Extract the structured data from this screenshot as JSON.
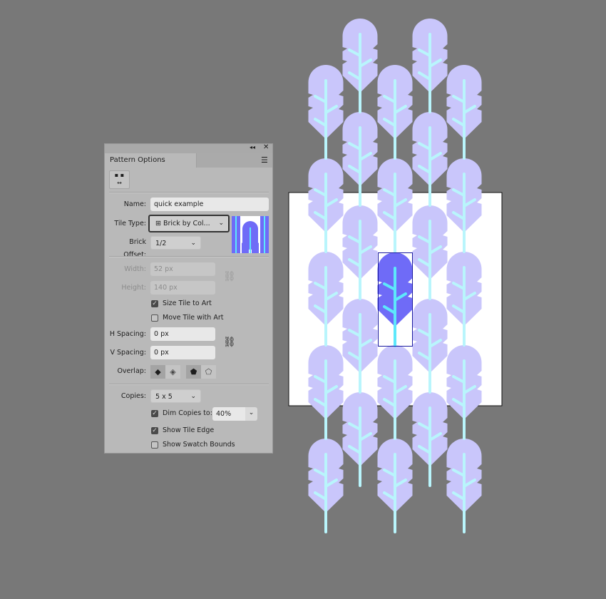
{
  "panel": {
    "title": "Pattern Options",
    "collapse_icon": "double-chevron-left-icon",
    "close_icon": "close-icon",
    "menu_icon": "hamburger-menu-icon",
    "tile_tool_icon": "pattern-tile-tool-icon",
    "name_label": "Name:",
    "name_value": "quick example",
    "tile_type_label": "Tile Type:",
    "tile_type_value": "Brick by Col...",
    "brick_offset_label": "Brick Offset:",
    "brick_offset_value": "1/2",
    "width_label": "Width:",
    "width_value": "52 px",
    "height_label": "Height:",
    "height_value": "140 px",
    "size_tile_to_art": {
      "label": "Size Tile to Art",
      "checked": true
    },
    "move_tile_with_art": {
      "label": "Move Tile with Art",
      "checked": false
    },
    "h_spacing_label": "H Spacing:",
    "h_spacing_value": "0 px",
    "v_spacing_label": "V Spacing:",
    "v_spacing_value": "0 px",
    "overlap_label": "Overlap:",
    "copies_label": "Copies:",
    "copies_value": "5 x 5",
    "dim_copies": {
      "label": "Dim Copies to:",
      "checked": true,
      "value": "40%"
    },
    "show_tile_edge": {
      "label": "Show Tile Edge",
      "checked": true
    },
    "show_swatch_bounds": {
      "label": "Show Swatch Bounds",
      "checked": false
    }
  },
  "colors": {
    "background": "#787878",
    "feather_dim": "#c9c6fb",
    "stem_dim": "#b9f5fc",
    "feather": "#6f6bf7",
    "stem": "#5de8fb",
    "tile_edge": "#1a1aa0"
  }
}
